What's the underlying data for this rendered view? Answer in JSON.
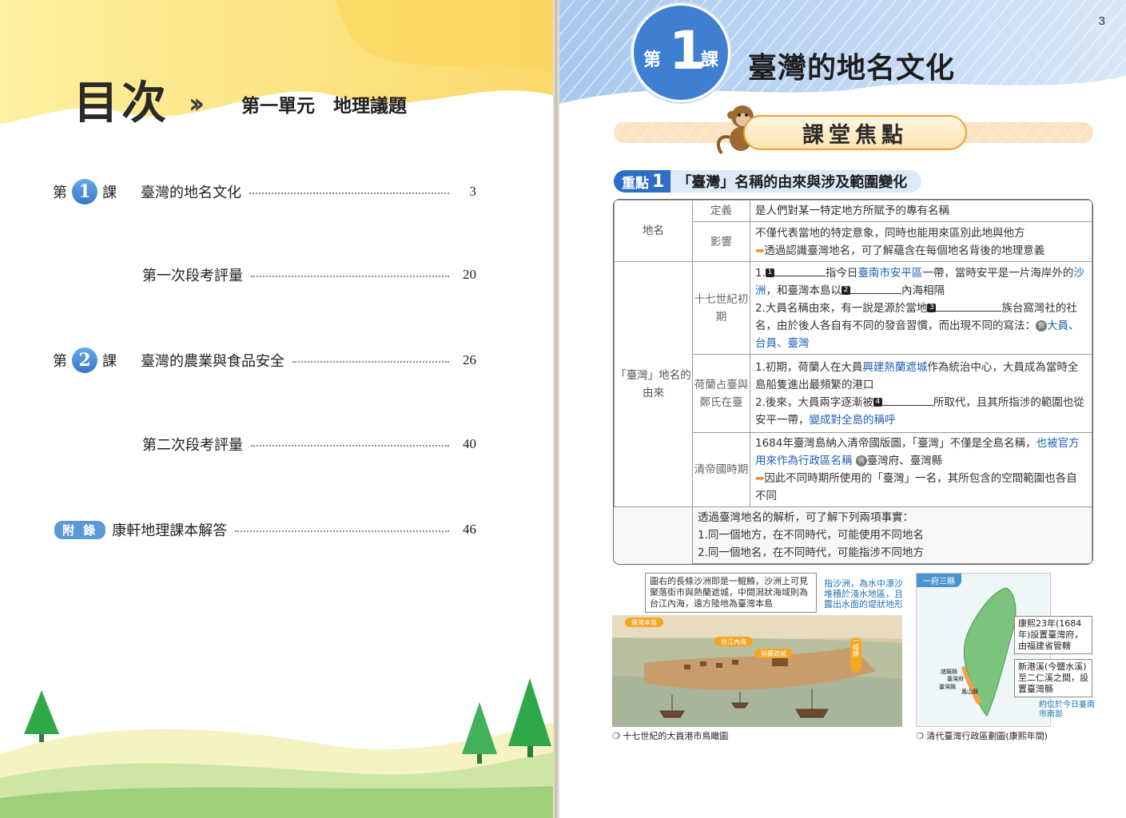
{
  "left_page": {
    "title": "目次",
    "arrows": "››",
    "unit_title": "第一單元　地理議題",
    "toc": [
      {
        "prefix": "第",
        "num": "1",
        "suffix": "課",
        "title": "臺灣的地名文化",
        "page": "3"
      },
      {
        "title": "第一次段考評量",
        "page": "20"
      },
      {
        "prefix": "第",
        "num": "2",
        "suffix": "課",
        "title": "臺灣的農業與食品安全",
        "page": "26"
      },
      {
        "title": "第二次段考評量",
        "page": "40"
      },
      {
        "tag": "附 錄",
        "title": "康軒地理課本解答",
        "page": "46"
      }
    ]
  },
  "right_page": {
    "page_number": "3",
    "lesson_badge": {
      "left": "第",
      "num": "1",
      "right": "課"
    },
    "lesson_title": "臺灣的地名文化",
    "focus_title": "課堂焦點",
    "point": {
      "badge": "重點",
      "num": "1",
      "label": "「臺灣」名稱的由來與涉及範圍變化"
    },
    "table": {
      "cat_placename": "地名",
      "sub_definition": "定義",
      "definition": "是人們對某一特定地方所賦予的專有名稱",
      "sub_influence": "影響",
      "influence_1": "不僅代表當地的特定意象，同時也能用來區別此地與他方",
      "influence_2": "透過認識臺灣地名，可了解蘊含在每個地名背後的地理意義",
      "cat_origin": "「臺灣」地名的由來",
      "sub_17c": "十七世紀初期",
      "c17_1a": "1.",
      "c17_1b": "指今日",
      "c17_1c": "臺南市安平區",
      "c17_1d": "一帶，當時安平是一片海岸外的",
      "c17_1e": "沙洲",
      "c17_1f": "，和臺灣本島以",
      "c17_1g": "內海相隔",
      "c17_2a": "2.大員名稱由來，有一說是源於當地",
      "c17_2b": "族台窩灣社的社名，由於後人各自有不同的發音習慣，而出現不同的寫法：",
      "c17_2c": "大員、台員、臺灣",
      "sub_dutch": "荷蘭占臺與鄭氏在臺",
      "dutch_1a": "1.初期，荷蘭人在大員",
      "dutch_1b": "興建熱蘭遮城",
      "dutch_1c": "作為統治中心，大員成為當時全島船隻進出最頻繁的港口",
      "dutch_2a": "2.後來，大員兩字逐漸被",
      "dutch_2b": "所取代，且其所指涉的範圍也從安平一帶，",
      "dutch_2c": "變成對全島的稱呼",
      "sub_qing": "清帝國時期",
      "qing_1a": "1684年臺灣島納入清帝國版圖，「臺灣」不僅是全島名稱，",
      "qing_1b": "也被官方用來作為行政區名稱",
      "qing_1c": "臺灣府、臺灣縣",
      "qing_2": "因此不同時期所使用的「臺灣」一名，其所包含的空間範圍也各自不同",
      "summary_1": "透過臺灣地名的解析，可了解下列兩項事實：",
      "summary_2": "1.同一個地方，在不同時代，可能使用不同地名",
      "summary_3": "2.同一個地名，在不同時代，可能指涉不同地方",
      "markers": [
        "1",
        "2",
        "3",
        "4"
      ],
      "example_mark": "例"
    },
    "figure1": {
      "callout": "圖右的長條沙洲即是一鯤鯓，沙洲上可見聚落街市與熱蘭遮城，中間潟狀海域則為台江內海，遠方陸地為臺灣本島",
      "note": "指沙洲，為水中漂沙堆積於淺水地區，且露出水面的堤狀地形",
      "labels": [
        "臺灣本島",
        "台江內海",
        "熱蘭遮城",
        "一鯤鯓"
      ],
      "caption": "十七世紀的大員港市鳥瞰圖"
    },
    "figure2": {
      "tag": "一府三縣",
      "note_1": "康熙23年(1684年)設置臺灣府，由福建省管轄",
      "note_2": "新港溪(今鹽水溪)至二仁溪之間，設置臺灣縣",
      "note_3": "約位於今日臺南市南部",
      "labels": [
        "諸羅縣",
        "臺灣府",
        "臺灣縣",
        "鳳山縣"
      ],
      "caption": "清代臺灣行政區劃圖(康熙年間)"
    }
  },
  "colors": {
    "blue": "#3f7fd2",
    "yellow": "#fbe27a",
    "orange": "#f0a030",
    "green": "#2fa84a",
    "highlight": "#1d5fb5"
  }
}
